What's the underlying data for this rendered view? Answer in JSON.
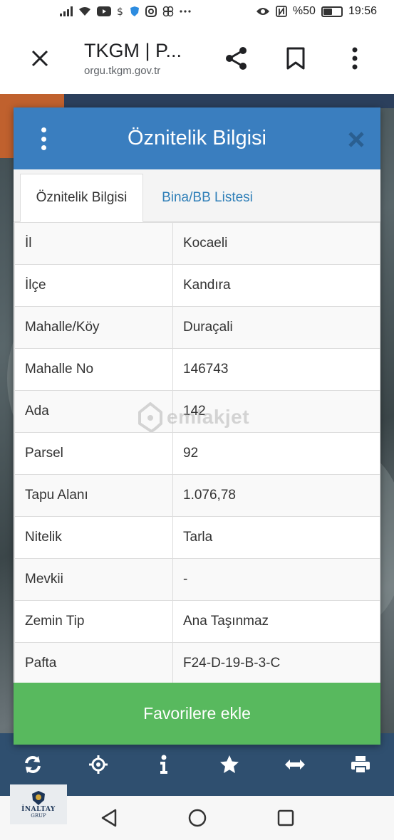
{
  "status_bar": {
    "battery": "%50",
    "time": "19:56",
    "battery_level": 0.5,
    "icons": [
      "signal-icon",
      "wifi-icon",
      "youtube-icon",
      "dollar-icon",
      "shield-icon",
      "instagram-icon",
      "flower-icon",
      "more-dots-icon",
      "eye-icon",
      "nfc-icon",
      "battery-icon"
    ]
  },
  "browser": {
    "title": "TKGM | P...",
    "url": "orgu.tkgm.gov.tr",
    "icons": [
      "close-icon",
      "share-icon",
      "bookmark-icon",
      "kebab-menu-icon"
    ]
  },
  "modal": {
    "title": "Öznitelik Bilgisi",
    "accent_color": "#3a7ebf",
    "tabs": [
      {
        "label": "Öznitelik Bilgisi",
        "active": true
      },
      {
        "label": "Bina/BB Listesi",
        "active": false
      }
    ],
    "rows": [
      {
        "key": "İl",
        "value": "Kocaeli"
      },
      {
        "key": "İlçe",
        "value": "Kandıra"
      },
      {
        "key": "Mahalle/Köy",
        "value": "Duraçali"
      },
      {
        "key": "Mahalle No",
        "value": "146743"
      },
      {
        "key": "Ada",
        "value": "142"
      },
      {
        "key": "Parsel",
        "value": "92"
      },
      {
        "key": "Tapu Alanı",
        "value": "1.076,78"
      },
      {
        "key": "Nitelik",
        "value": "Tarla"
      },
      {
        "key": "Mevkii",
        "value": "-"
      },
      {
        "key": "Zemin Tip",
        "value": "Ana Taşınmaz"
      },
      {
        "key": "Pafta",
        "value": "F24-D-19-B-3-C"
      }
    ],
    "favorite_button": "Favorilere ekle",
    "favorite_color": "#58b95e"
  },
  "watermark": {
    "text": "emlakjet"
  },
  "map_toolbar": {
    "color": "#2f4f6f",
    "icons": [
      "refresh-icon",
      "crosshair-icon",
      "info-icon",
      "star-icon",
      "measure-icon",
      "print-icon"
    ]
  },
  "logo": {
    "text": "İNALTAY",
    "sub": "GRUP"
  },
  "nav_bar": {
    "icons": [
      "back-icon",
      "home-icon",
      "recents-icon"
    ]
  }
}
